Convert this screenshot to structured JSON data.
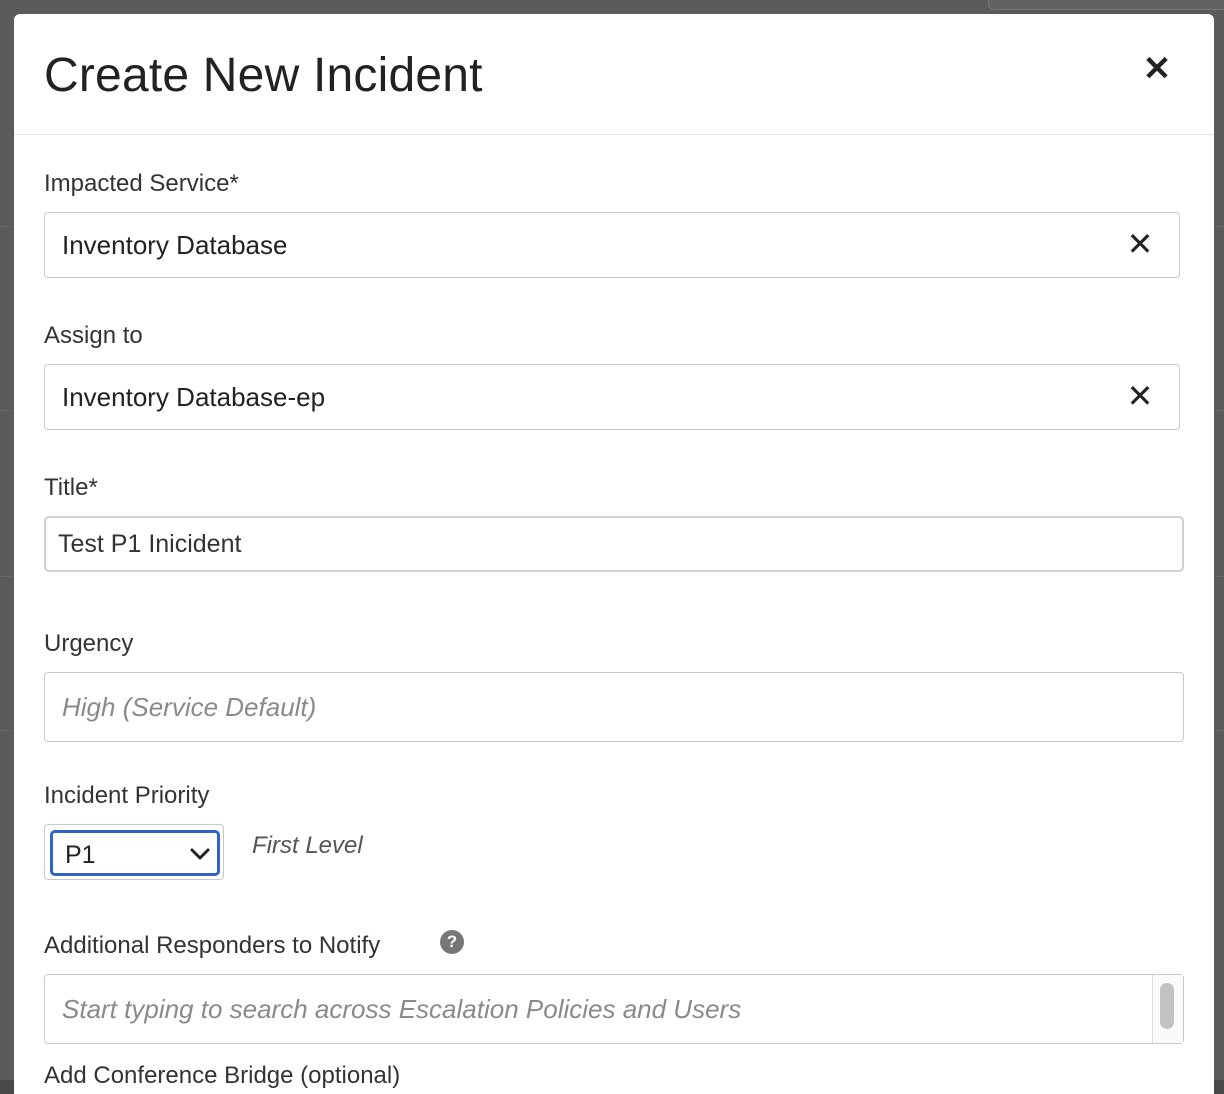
{
  "modal": {
    "title": "Create New Incident",
    "close_label": "✕"
  },
  "fields": {
    "impacted_service": {
      "label": "Impacted Service*",
      "value": "Inventory Database",
      "clear_label": "✕"
    },
    "assign_to": {
      "label": "Assign to",
      "value": "Inventory Database-ep",
      "clear_label": "✕"
    },
    "title": {
      "label": "Title*",
      "value": "Test P1 Inicident"
    },
    "urgency": {
      "label": "Urgency",
      "placeholder": "High (Service Default)"
    },
    "incident_priority": {
      "label": "Incident Priority",
      "selected": "P1",
      "hint": "First Level"
    },
    "additional_responders": {
      "label": "Additional Responders to Notify",
      "help_label": "?",
      "placeholder": "Start typing to search across Escalation Policies and Users"
    },
    "conference_bridge": {
      "label": "Add Conference Bridge (optional)"
    }
  },
  "colors": {
    "focus_border": "#2f63c7",
    "text_primary": "#222222",
    "placeholder": "#8a8a8a"
  },
  "icons": {
    "close": "close-icon",
    "clear": "clear-icon",
    "chevron": "chevron-down-icon",
    "help": "question-circle-icon"
  }
}
